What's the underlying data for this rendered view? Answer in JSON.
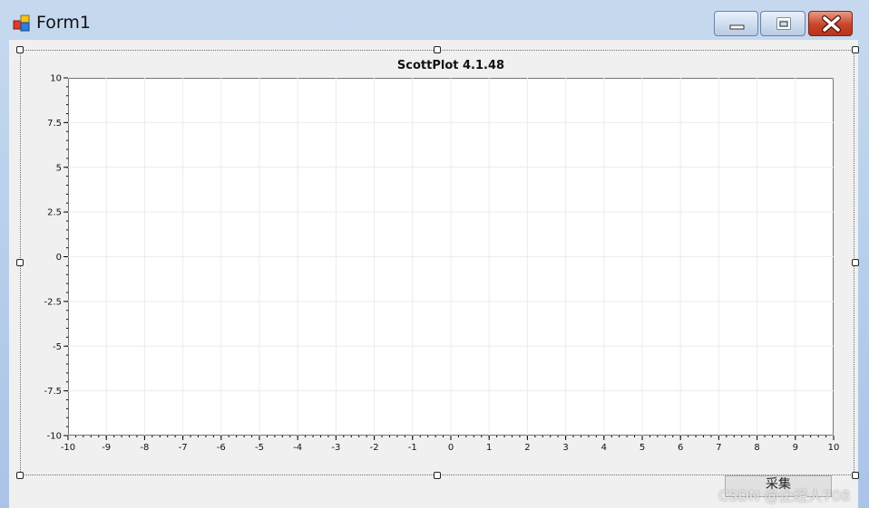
{
  "window": {
    "title": "Form1",
    "controls": {
      "minimize": "minimize",
      "maximize": "maximize",
      "close": "close"
    }
  },
  "form": {
    "button_label": "采集"
  },
  "watermark": "CSDN @止经人708",
  "chart_data": {
    "type": "scatter",
    "title": "ScottPlot 4.1.48",
    "xlabel": "",
    "ylabel": "",
    "xlim": [
      -10,
      10
    ],
    "ylim": [
      -10,
      10
    ],
    "xticks": [
      "-10",
      "-9",
      "-8",
      "-7",
      "-6",
      "-5",
      "-4",
      "-3",
      "-2",
      "-1",
      "0",
      "1",
      "2",
      "3",
      "4",
      "5",
      "6",
      "7",
      "8",
      "9",
      "10"
    ],
    "yticks": [
      "10",
      "7.5",
      "5",
      "2.5",
      "0",
      "-2.5",
      "-5",
      "-7.5",
      "-10"
    ],
    "grid": true,
    "series": []
  }
}
